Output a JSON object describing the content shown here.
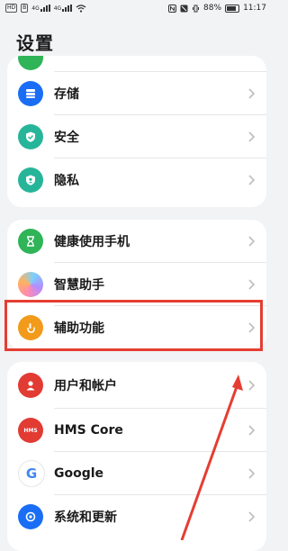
{
  "status_bar": {
    "left_chips": [
      "HD",
      "B",
      "4G",
      "4G"
    ],
    "battery": "88%",
    "time": "11:17"
  },
  "title": "设置",
  "colors": {
    "accent_red": "#e63d32",
    "blue": "#1a6ef5",
    "teal": "#27b59a",
    "green": "#2fb457",
    "orange": "#f29a1a",
    "red": "#e23b33"
  },
  "sections": {
    "privacy": {
      "top_partial_label": "",
      "items": [
        {
          "label": "存储",
          "icon": "storage-icon"
        },
        {
          "label": "安全",
          "icon": "shield-icon"
        },
        {
          "label": "隐私",
          "icon": "privacy-icon"
        }
      ]
    },
    "assist": {
      "items": [
        {
          "label": "健康使用手机",
          "icon": "hourglass-icon"
        },
        {
          "label": "智慧助手",
          "icon": "smart-assistant-icon"
        },
        {
          "label": "辅助功能",
          "icon": "accessibility-hand-icon"
        }
      ]
    },
    "accounts": {
      "items": [
        {
          "label": "用户和帐户",
          "icon": "user-icon"
        },
        {
          "label": "HMS Core",
          "icon": "hms-core-icon",
          "icon_text": "HMS"
        },
        {
          "label": "Google",
          "icon": "google-icon",
          "icon_text": "G"
        },
        {
          "label": "系统和更新",
          "icon": "system-update-icon"
        }
      ]
    }
  }
}
